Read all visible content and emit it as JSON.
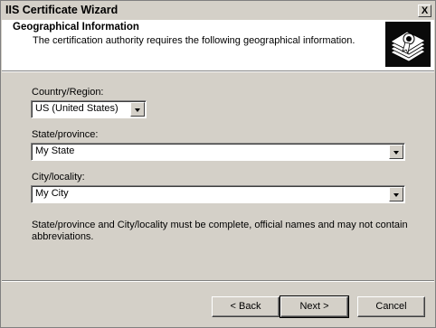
{
  "window": {
    "title": "IIS Certificate Wizard",
    "close_glyph": "X"
  },
  "header": {
    "title": "Geographical Information",
    "subtitle": "The certification authority requires the following geographical information.",
    "icon": "certificate-wizard-icon"
  },
  "fields": {
    "country": {
      "label": "Country/Region:",
      "value": "US (United States)"
    },
    "state": {
      "label": "State/province:",
      "value": "My State"
    },
    "city": {
      "label": "City/locality:",
      "value": "My City"
    }
  },
  "note": "State/province and City/locality must be complete, official names and may not contain abbreviations.",
  "buttons": {
    "back": "< Back",
    "next": "Next >",
    "cancel": "Cancel"
  }
}
